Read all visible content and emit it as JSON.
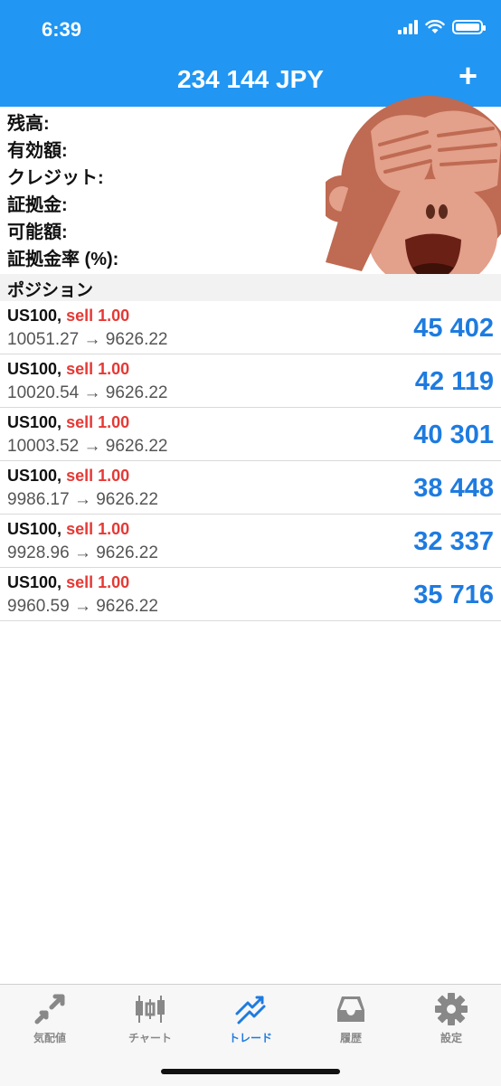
{
  "status": {
    "time": "6:39"
  },
  "header": {
    "title": "234 144 JPY",
    "add_label": "+"
  },
  "summary": [
    "残高:",
    "有効額:",
    "クレジット:",
    "証拠金:",
    "可能額:",
    "証拠金率 (%):"
  ],
  "section_title": "ポジション",
  "positions": [
    {
      "symbol": "US100,",
      "side": "sell 1.00",
      "prices": "10051.27 → 9626.22",
      "profit": "45 402"
    },
    {
      "symbol": "US100,",
      "side": "sell 1.00",
      "prices": "10020.54 → 9626.22",
      "profit": "42 119"
    },
    {
      "symbol": "US100,",
      "side": "sell 1.00",
      "prices": "10003.52 → 9626.22",
      "profit": "40 301"
    },
    {
      "symbol": "US100,",
      "side": "sell 1.00",
      "prices": "9986.17 → 9626.22",
      "profit": "38 448"
    },
    {
      "symbol": "US100,",
      "side": "sell 1.00",
      "prices": "9928.96 → 9626.22",
      "profit": "32 337"
    },
    {
      "symbol": "US100,",
      "side": "sell 1.00",
      "prices": "9960.59 → 9626.22",
      "profit": "35 716"
    }
  ],
  "tabs": [
    {
      "label": "気配値",
      "icon": "quotes-icon"
    },
    {
      "label": "チャート",
      "icon": "chart-icon"
    },
    {
      "label": "トレード",
      "icon": "trade-icon"
    },
    {
      "label": "履歴",
      "icon": "history-icon"
    },
    {
      "label": "設定",
      "icon": "settings-icon"
    }
  ],
  "colors": {
    "header": "#2196f3",
    "profit": "#1e7be0",
    "sell": "#e53935",
    "tab_active": "#1e7be0",
    "tab_inactive": "#888888"
  }
}
